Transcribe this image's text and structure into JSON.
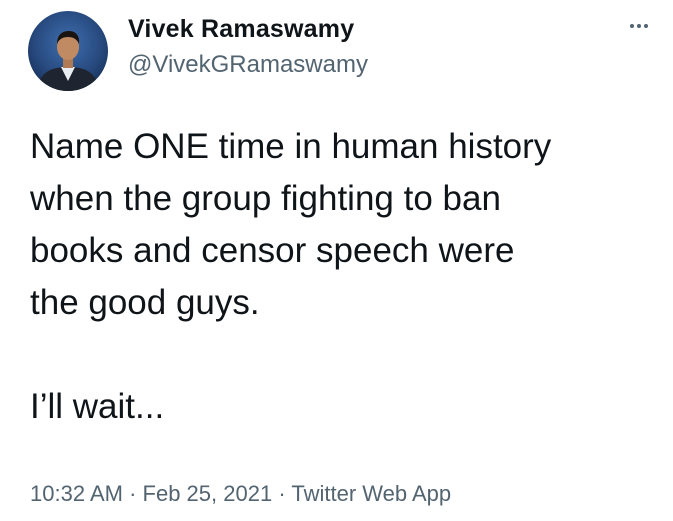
{
  "author": {
    "name": "Vivek Ramaswamy",
    "handle": "@VivekGRamaswamy",
    "avatar_icon": "profile-photo"
  },
  "menu": {
    "icon": "more-options-icon"
  },
  "tweet": {
    "lines": [
      "Name ONE time in human history",
      "when the group fighting to ban",
      "books and censor speech were",
      "the good guys."
    ],
    "closing": "I’ll wait..."
  },
  "meta": {
    "time": "10:32 AM",
    "separator": "·",
    "date": "Feb 25, 2021",
    "source": "Twitter Web App"
  },
  "colors": {
    "text": "#0f1419",
    "secondary": "#536471"
  }
}
